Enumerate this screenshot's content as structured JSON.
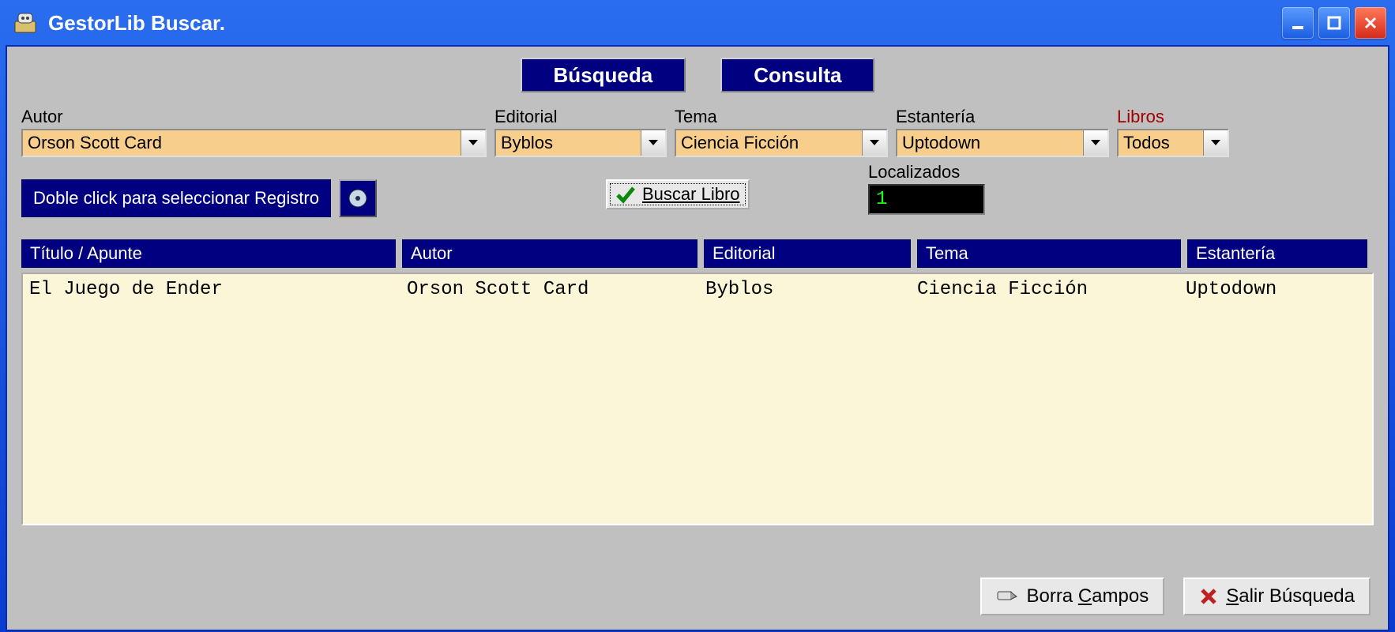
{
  "window": {
    "title": "GestorLib  Buscar."
  },
  "tabs": {
    "busqueda": "Búsqueda",
    "consulta": "Consulta"
  },
  "filters": {
    "autor": {
      "label": "Autor",
      "value": "Orson Scott Card"
    },
    "editorial": {
      "label": "Editorial",
      "value": "Byblos"
    },
    "tema": {
      "label": "Tema",
      "value": "Ciencia Ficción"
    },
    "estanteria": {
      "label": "Estantería",
      "value": "Uptodown"
    },
    "libros": {
      "label": "Libros",
      "value": "Todos"
    }
  },
  "hint": "Doble click para seleccionar Registro",
  "buscar_libro": "Buscar Libro",
  "localizados": {
    "label": "Localizados",
    "value": "1"
  },
  "columns": {
    "titulo": "Título / Apunte",
    "autor": "Autor",
    "editorial": "Editorial",
    "tema": "Tema",
    "estanteria": "Estantería"
  },
  "rows": [
    {
      "titulo": "El Juego de Ender",
      "autor": "Orson Scott Card",
      "editorial": "Byblos",
      "tema": "Ciencia Ficción",
      "estanteria": "Uptodown"
    }
  ],
  "footer": {
    "borra": "Borra Campos",
    "salir": "Salir Búsqueda"
  }
}
